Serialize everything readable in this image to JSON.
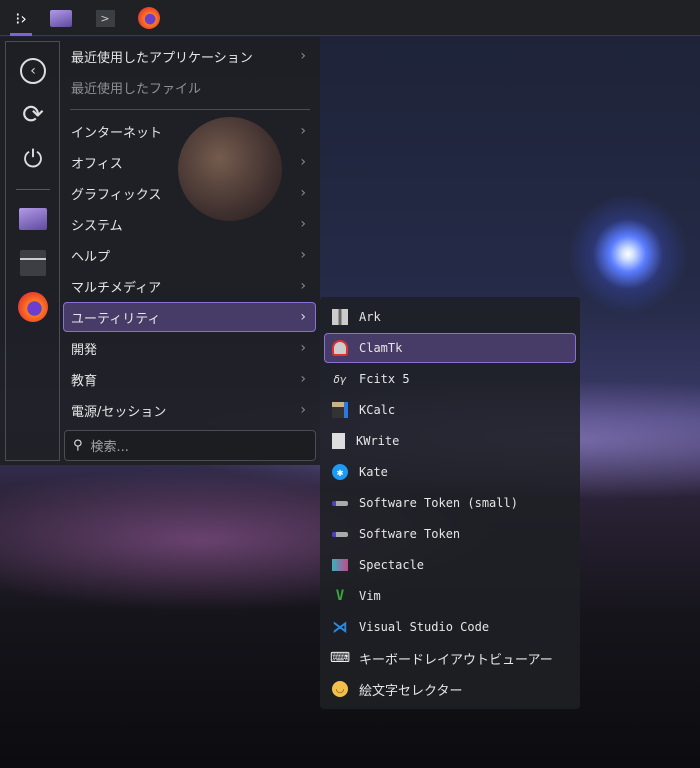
{
  "taskbar": {
    "items": [
      "application-launcher",
      "file-manager",
      "terminal",
      "firefox"
    ]
  },
  "favorites": [
    "back",
    "refresh",
    "power",
    "file-manager",
    "settings",
    "firefox"
  ],
  "menu": {
    "recent_apps": "最近使用したアプリケーション",
    "recent_files": "最近使用したファイル",
    "categories": [
      "インターネット",
      "オフィス",
      "グラフィックス",
      "システム",
      "ヘルプ",
      "マルチメディア",
      "ユーティリティ",
      "開発",
      "教育",
      "電源/セッション"
    ],
    "search_placeholder": "検索..."
  },
  "submenu": {
    "items": [
      "Ark",
      "ClamTk",
      "Fcitx 5",
      "KCalc",
      "KWrite",
      "Kate",
      "Software Token (small)",
      "Software Token",
      "Spectacle",
      "Vim",
      "Visual Studio Code",
      "キーボードレイアウトビューアー",
      "絵文字セレクター"
    ]
  },
  "colors": {
    "accent": "#7e63d6",
    "highlight": "#473b68"
  }
}
